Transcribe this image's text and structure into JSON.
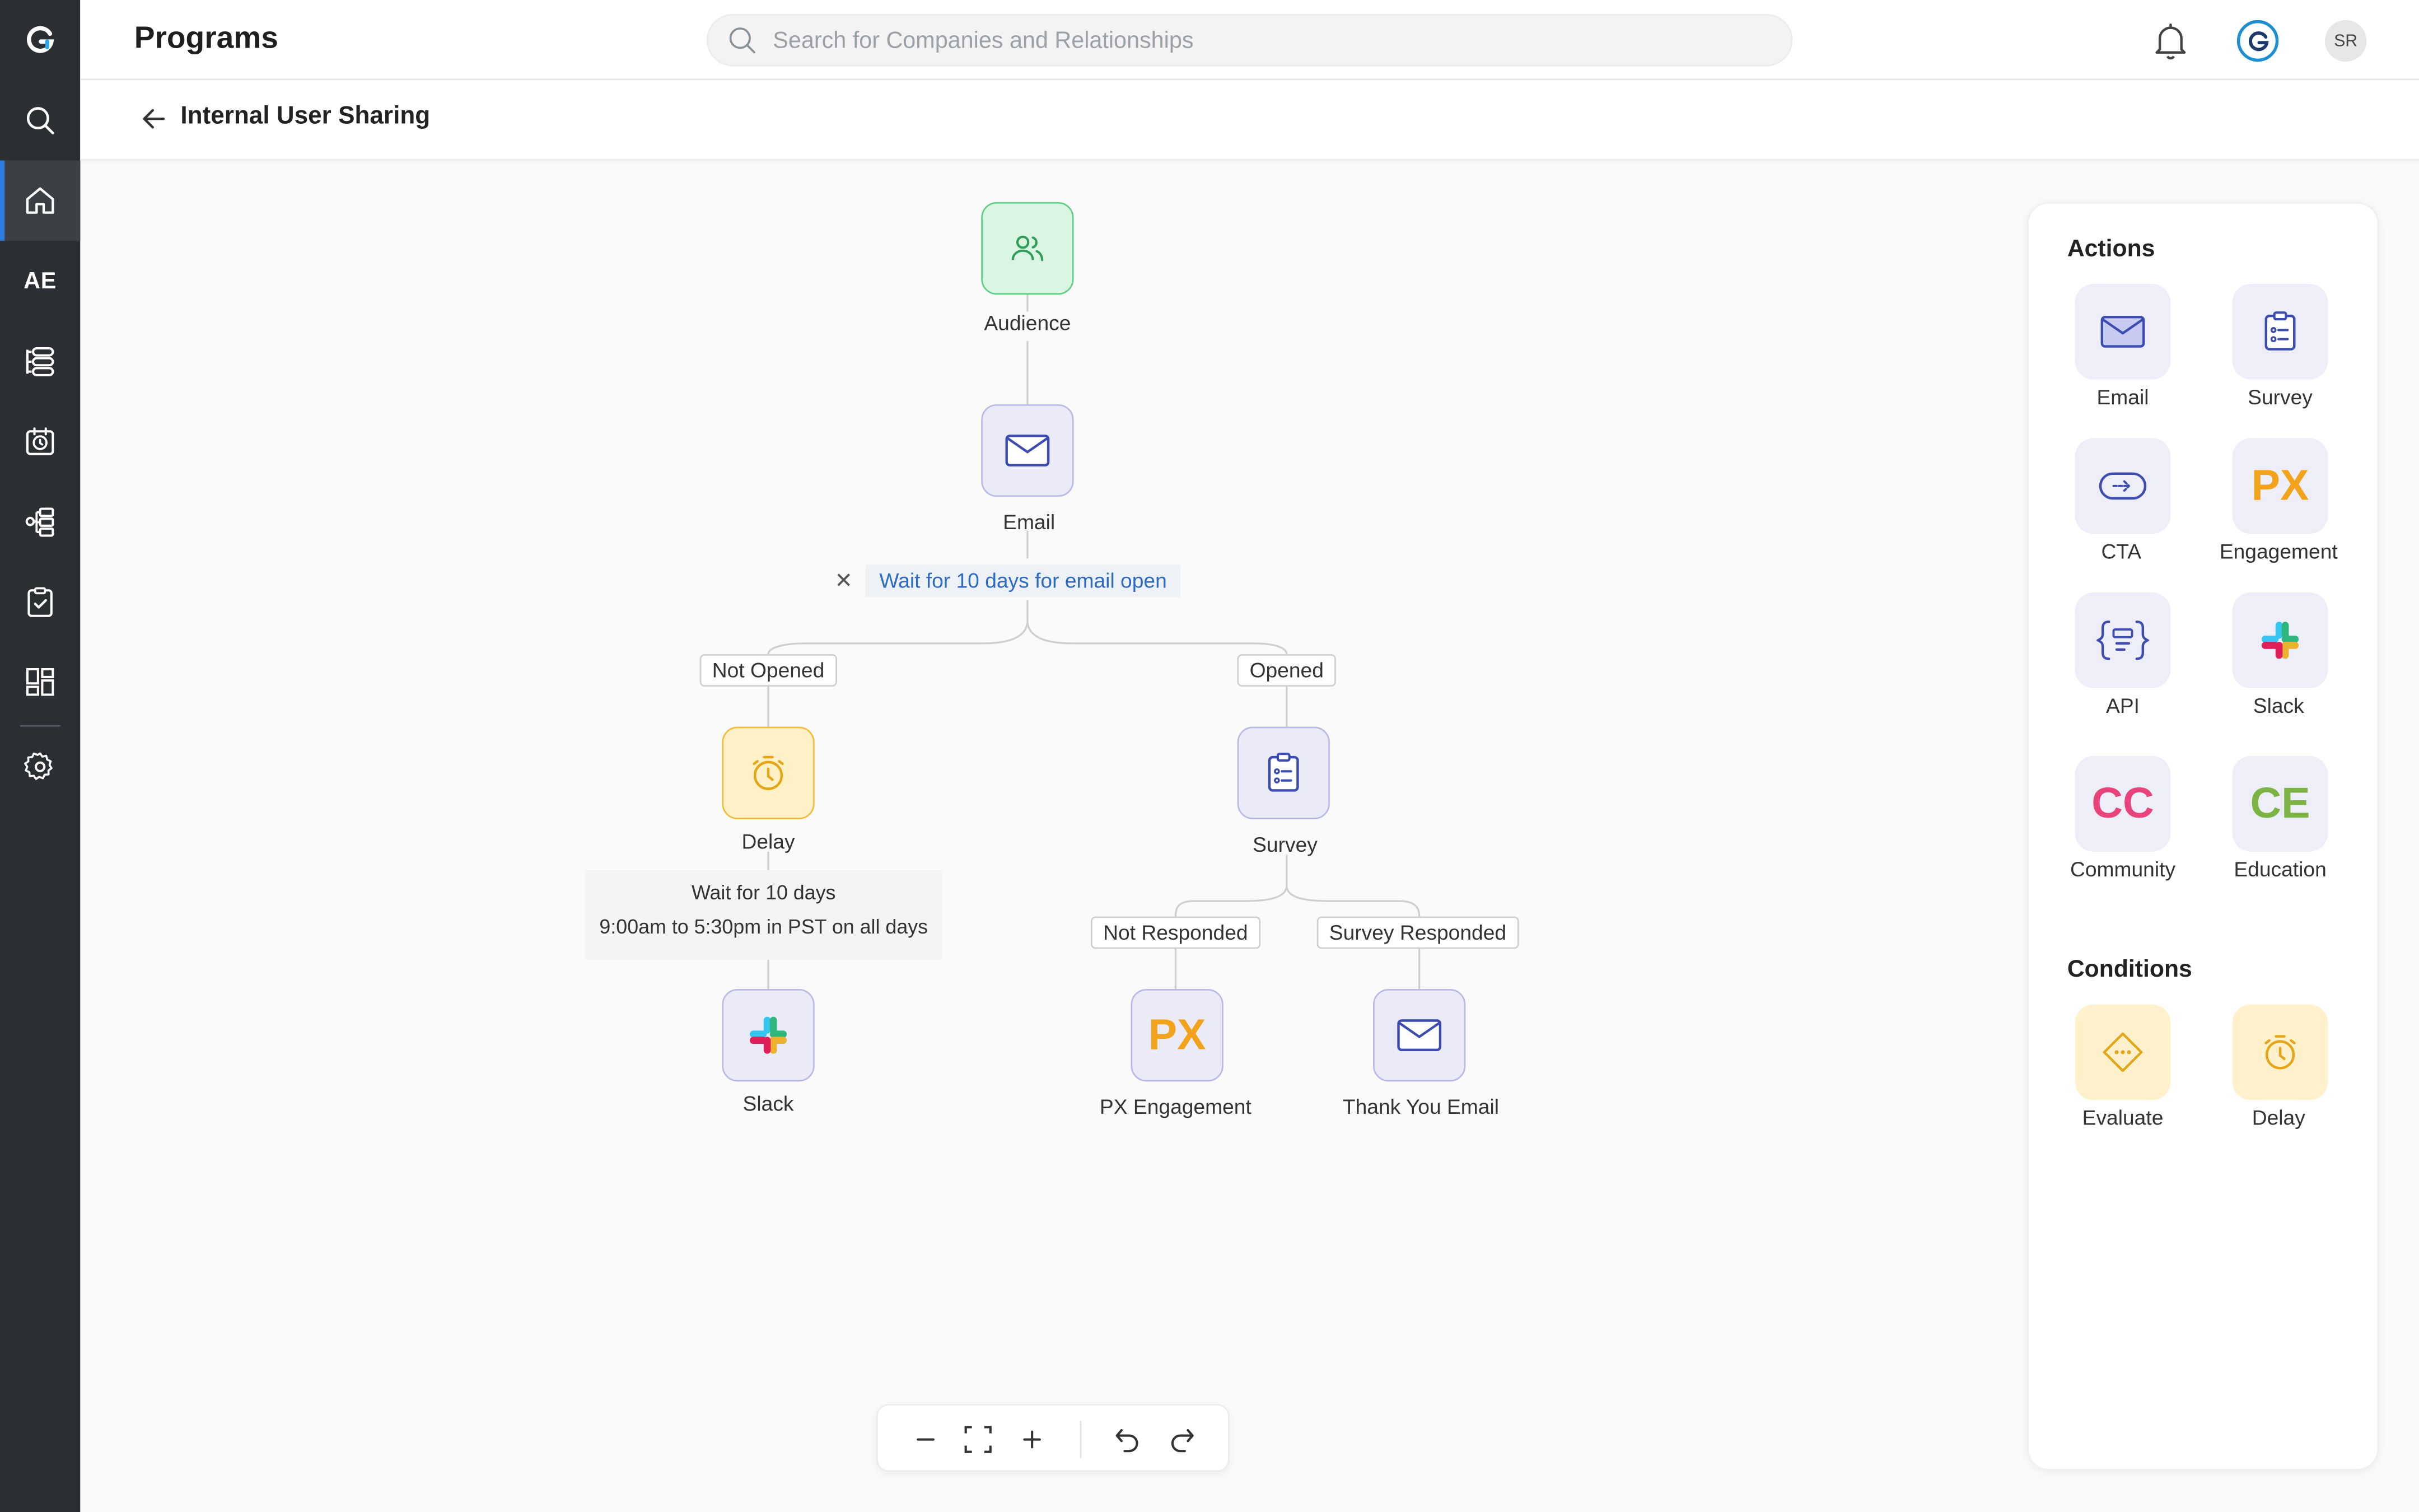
{
  "header": {
    "title": "Programs",
    "search_placeholder": "Search for Companies and Relationships",
    "user_initials": "SR"
  },
  "sidebar": {
    "items": [
      {
        "name": "search",
        "icon": "search-icon"
      },
      {
        "name": "home",
        "icon": "home-icon",
        "active": true
      },
      {
        "name": "ae",
        "label": "AE"
      },
      {
        "name": "timeline",
        "icon": "list-icon"
      },
      {
        "name": "schedule",
        "icon": "calendar-clock-icon"
      },
      {
        "name": "hierarchy",
        "icon": "hierarchy-icon"
      },
      {
        "name": "tasks",
        "icon": "clipboard-check-icon"
      },
      {
        "name": "dashboards",
        "icon": "dashboard-icon"
      },
      {
        "name": "settings",
        "icon": "gear-icon"
      }
    ]
  },
  "breadcrumb": {
    "title": "Internal User Sharing"
  },
  "flow": {
    "audience_label": "Audience",
    "email_label": "Email",
    "wait_condition": "Wait for 10 days for email open",
    "branch_not_opened": "Not Opened",
    "branch_opened": "Opened",
    "delay_label": "Delay",
    "survey_label": "Survey",
    "delay_note_line1": "Wait for 10 days",
    "delay_note_line2": "9:00am to 5:30pm in PST on all days",
    "branch_not_responded": "Not Responded",
    "branch_survey_responded": "Survey Responded",
    "slack_label": "Slack",
    "px_label": "PX Engagement",
    "px_text": "PX",
    "thank_you_label": "Thank You Email"
  },
  "panel": {
    "actions_heading": "Actions",
    "actions": [
      {
        "label": "Email",
        "icon": "email-icon"
      },
      {
        "label": "Survey",
        "icon": "survey-icon"
      },
      {
        "label": "CTA",
        "icon": "cta-icon"
      },
      {
        "label": "Engagement",
        "icon": "px-icon",
        "text": "PX"
      },
      {
        "label": "API",
        "icon": "api-icon"
      },
      {
        "label": "Slack",
        "icon": "slack-icon"
      },
      {
        "label": "Community",
        "icon": "community-icon",
        "text": "CC"
      },
      {
        "label": "Education",
        "icon": "education-icon",
        "text": "CE"
      }
    ],
    "conditions_heading": "Conditions",
    "conditions": [
      {
        "label": "Evaluate",
        "icon": "evaluate-icon"
      },
      {
        "label": "Delay",
        "icon": "delay-icon"
      }
    ]
  },
  "colors": {
    "sidebar_bg": "#2b2f33",
    "accent": "#2f7de1",
    "px_orange": "#f3a21b",
    "cc_pink": "#e8437a",
    "ce_green": "#7cb342",
    "link_blue": "#2b6bc4"
  }
}
